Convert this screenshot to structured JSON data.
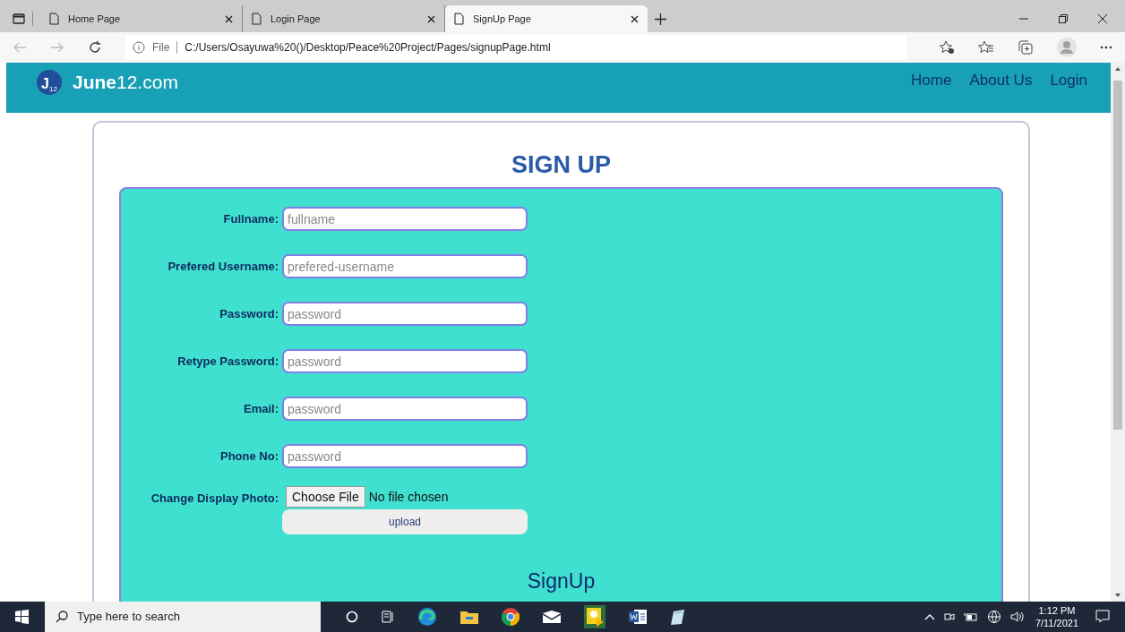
{
  "browser": {
    "tabs": [
      {
        "title": "Home Page",
        "selected": false
      },
      {
        "title": "Login Page",
        "selected": false
      },
      {
        "title": "SignUp Page",
        "selected": true
      }
    ],
    "address": {
      "scheme": "File",
      "url": "C:/Users/Osayuwa%20()/Desktop/Peace%20Project/Pages/signupPage.html"
    }
  },
  "site": {
    "logo": {
      "letter": "J",
      "sub": "12"
    },
    "brand": "**June**12.com",
    "nav": [
      "Home",
      "About Us",
      "Login"
    ]
  },
  "form": {
    "title": "SIGN UP",
    "fields": [
      {
        "label": "Fullname:",
        "placeholder": "fullname"
      },
      {
        "label": "Prefered Username:",
        "placeholder": "prefered-username"
      },
      {
        "label": "Password:",
        "placeholder": "password"
      },
      {
        "label": "Retype Password:",
        "placeholder": "password"
      },
      {
        "label": "Email:",
        "placeholder": "password"
      },
      {
        "label": "Phone No:",
        "placeholder": "password"
      }
    ],
    "photo": {
      "label": "Change Display Photo:",
      "choose": "Choose File",
      "status": "No file chosen",
      "upload": "upload"
    },
    "submit": "SignUp"
  },
  "taskbar": {
    "search": "Type here to search",
    "time": "1:12 PM",
    "date": "7/11/2021"
  }
}
